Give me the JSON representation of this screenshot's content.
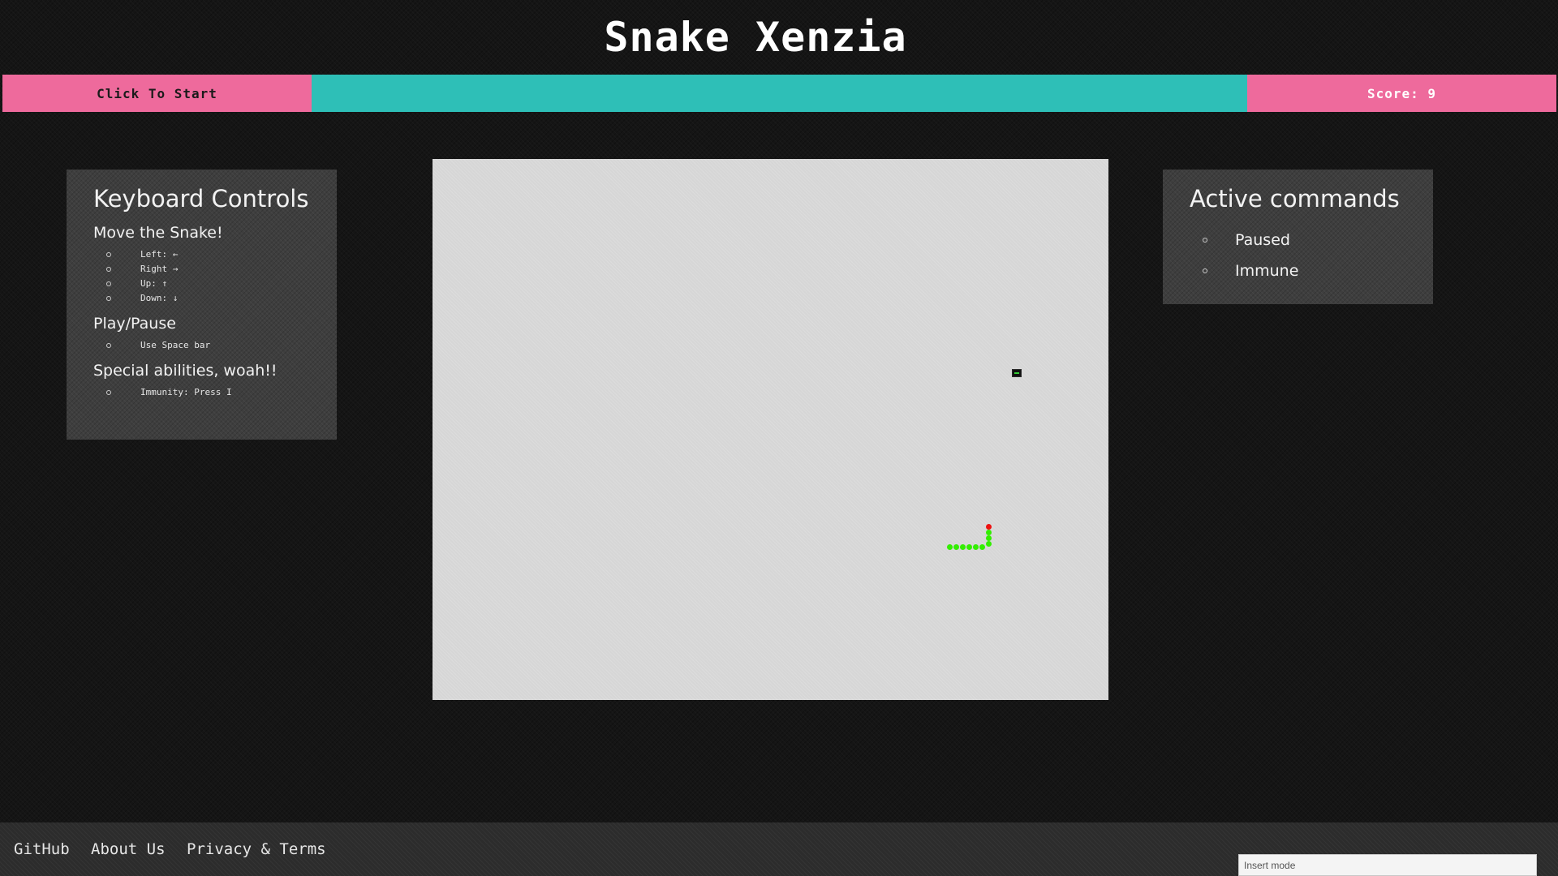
{
  "header": {
    "title": "Snake Xenzia"
  },
  "topbar": {
    "start_label": "Click To Start",
    "score_label": "Score: 9",
    "colors": {
      "pink": "#ee6a9c",
      "teal": "#2ebfb7"
    }
  },
  "controls_panel": {
    "title": "Keyboard Controls",
    "sections": [
      {
        "heading": "Move the Snake!",
        "items": [
          "Left: ←",
          "Right →",
          "Up: ↑",
          "Down: ↓"
        ]
      },
      {
        "heading": "Play/Pause",
        "items": [
          "Use Space bar"
        ]
      },
      {
        "heading": "Special abilities, woah!!",
        "items": [
          "Immunity: Press I"
        ]
      }
    ]
  },
  "active_panel": {
    "title": "Active commands",
    "items": [
      "Paused",
      "Immune"
    ]
  },
  "game": {
    "board_color": "#d6d6d6",
    "snake_color": "#33ee00",
    "head_color": "#ee1111",
    "food_icon": "food-block-icon"
  },
  "footer": {
    "links": [
      "GitHub",
      "About Us",
      "Privacy & Terms"
    ],
    "mode_text": "Insert mode"
  }
}
